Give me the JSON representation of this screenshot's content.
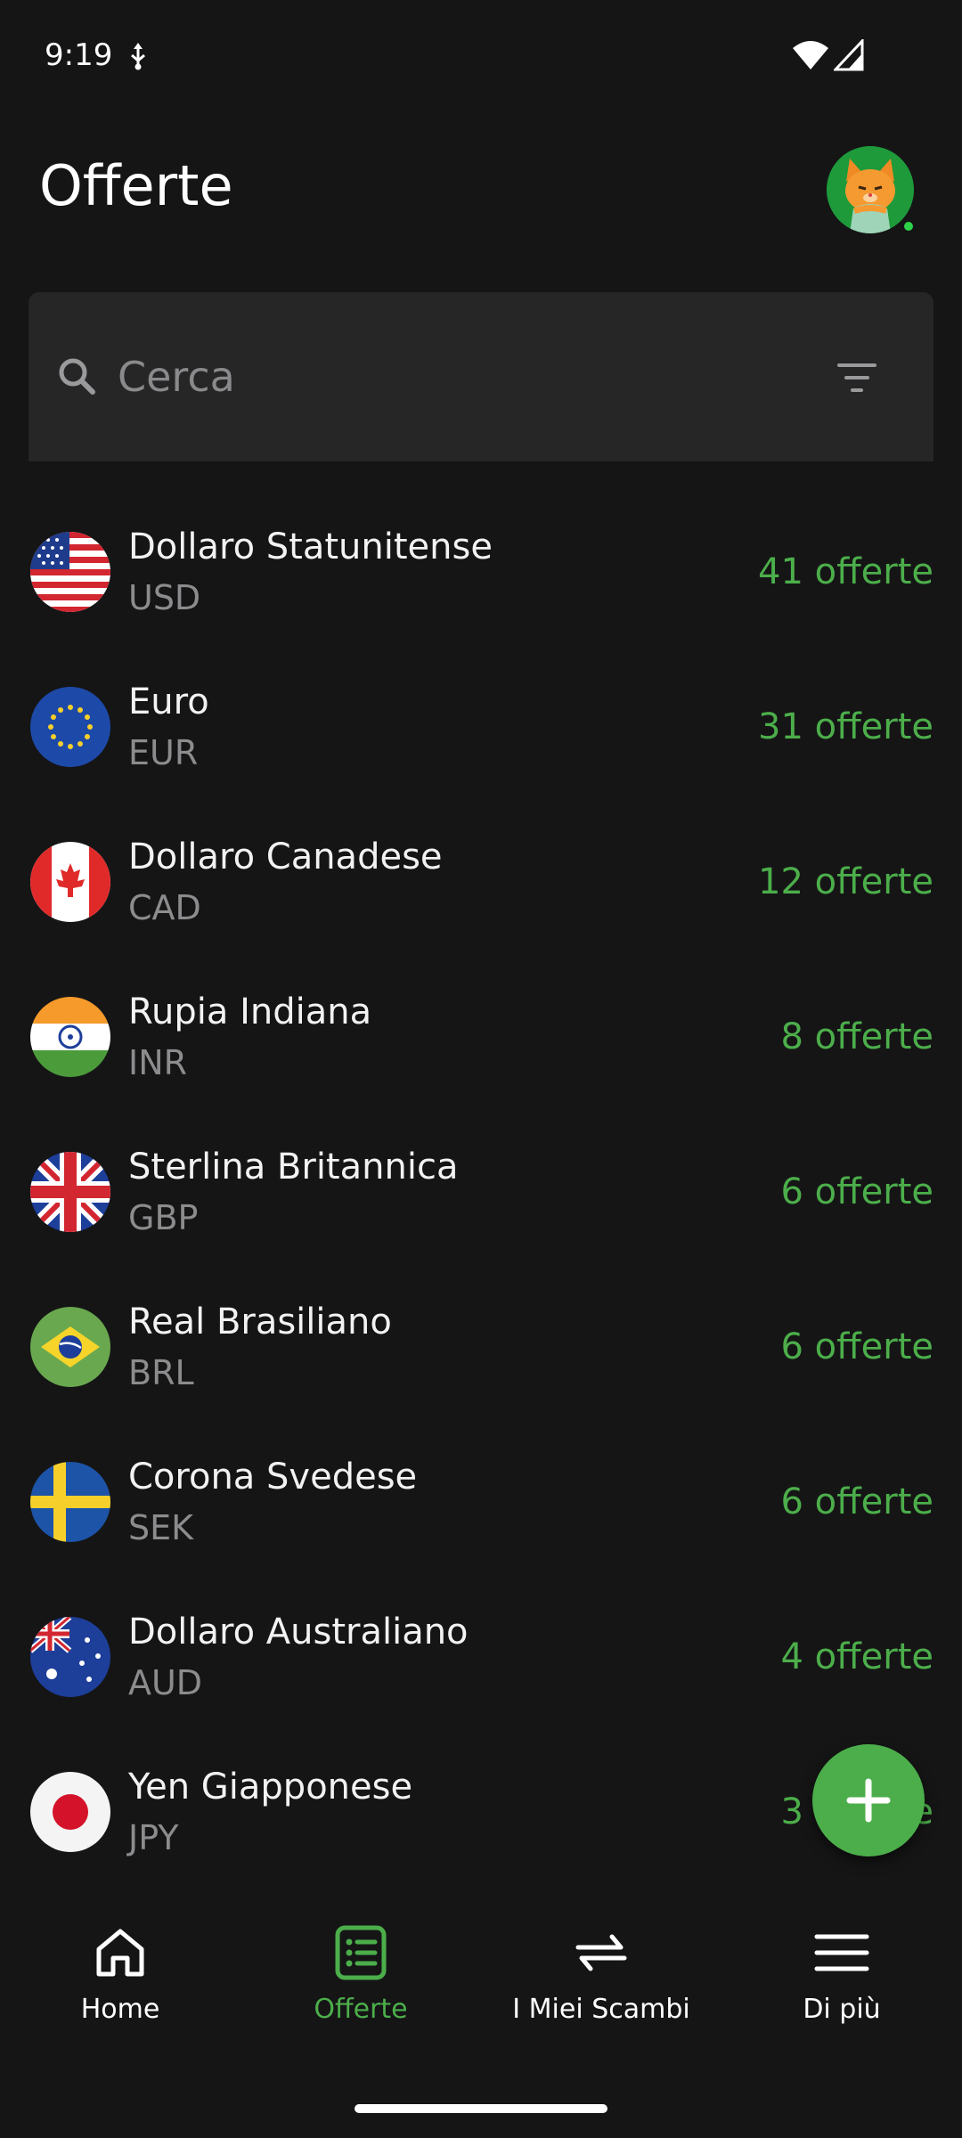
{
  "status_bar": {
    "time": "9:19"
  },
  "header": {
    "title": "Offerte"
  },
  "search": {
    "placeholder": "Cerca",
    "value": ""
  },
  "currencies": [
    {
      "name": "Dollaro Statunitense",
      "code": "USD",
      "offers": "41 offerte",
      "flag": "us-flag-icon"
    },
    {
      "name": "Euro",
      "code": "EUR",
      "offers": "31 offerte",
      "flag": "eu-flag-icon"
    },
    {
      "name": "Dollaro Canadese",
      "code": "CAD",
      "offers": "12 offerte",
      "flag": "ca-flag-icon"
    },
    {
      "name": "Rupia Indiana",
      "code": "INR",
      "offers": "8 offerte",
      "flag": "in-flag-icon"
    },
    {
      "name": "Sterlina Britannica",
      "code": "GBP",
      "offers": "6 offerte",
      "flag": "gb-flag-icon"
    },
    {
      "name": "Real Brasiliano",
      "code": "BRL",
      "offers": "6 offerte",
      "flag": "br-flag-icon"
    },
    {
      "name": "Corona Svedese",
      "code": "SEK",
      "offers": "6 offerte",
      "flag": "se-flag-icon"
    },
    {
      "name": "Dollaro Australiano",
      "code": "AUD",
      "offers": "4 offerte",
      "flag": "au-flag-icon"
    },
    {
      "name": "Yen Giapponese",
      "code": "JPY",
      "offers": "3 offerte",
      "flag": "jp-flag-icon"
    }
  ],
  "fab": {
    "icon": "plus-icon"
  },
  "bottom_nav": [
    {
      "label": "Home",
      "icon": "home-icon",
      "active": false
    },
    {
      "label": "Offerte",
      "icon": "list-icon",
      "active": true
    },
    {
      "label": "I Miei Scambi",
      "icon": "swap-icon",
      "active": false
    },
    {
      "label": "Di più",
      "icon": "menu-icon",
      "active": false
    }
  ],
  "colors": {
    "accent": "#4cae4a",
    "background": "#151516",
    "search_bg": "#262627",
    "secondary_text": "#8c8c8e"
  }
}
